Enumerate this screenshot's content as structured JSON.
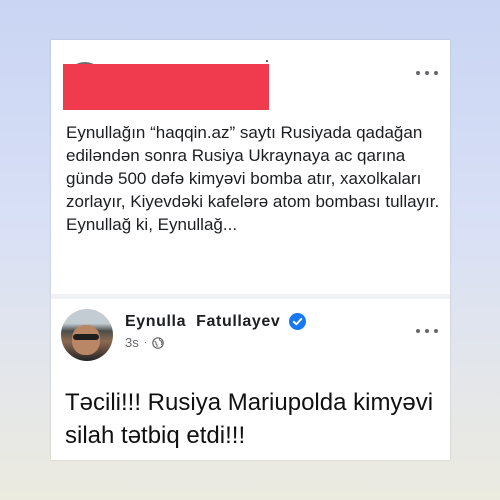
{
  "post1": {
    "text": "Eynullağın “haqqin.az” saytı Rusiyada qadağan ediləndən sonra Rusiya Ukraynaya ac qarına gündə 500 dəfə kimyəvi bomba atır, xaxolkaları zorlayır, Kiyevdəki kafelərə atom bombası tullayır. Eynullağ ki, Eynullağ...",
    "author_redacted": true,
    "redaction_color": "#f03a4e",
    "more_icon": "more-horizontal-icon"
  },
  "post2": {
    "author": "Eynulla  Fatullayev",
    "verified_icon": "verified-badge-icon",
    "time": "3s",
    "separator": "·",
    "audience_icon": "globe-icon",
    "text": "Təcili!!! Rusiya Mariupolda kimyəvi silah tətbiq etdi!!!",
    "more_icon": "more-horizontal-icon"
  },
  "colors": {
    "verified_blue": "#1877f2",
    "secondary_text": "#65676b"
  }
}
